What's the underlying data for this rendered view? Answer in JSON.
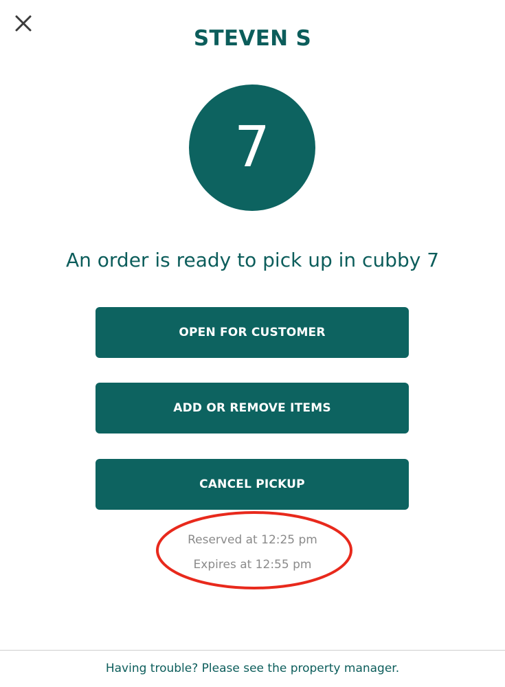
{
  "header": {
    "close_icon": "close-icon",
    "title": "STEVEN S"
  },
  "cubby": {
    "number": "7",
    "color": "#0d6360"
  },
  "message": "An order is ready to pick up in cubby 7",
  "actions": {
    "open_label": "OPEN FOR CUSTOMER",
    "items_label": "ADD OR REMOVE ITEMS",
    "cancel_label": "CANCEL PICKUP"
  },
  "reservation": {
    "reserved": "Reserved at 12:25 pm",
    "expires": "Expires at 12:55 pm"
  },
  "annotation": {
    "shape": "ellipse",
    "color": "#e8291c"
  },
  "footer": {
    "text": "Having trouble? Please see the property manager."
  },
  "colors": {
    "primary": "#0d6360",
    "text_muted": "#8a8a8a"
  }
}
